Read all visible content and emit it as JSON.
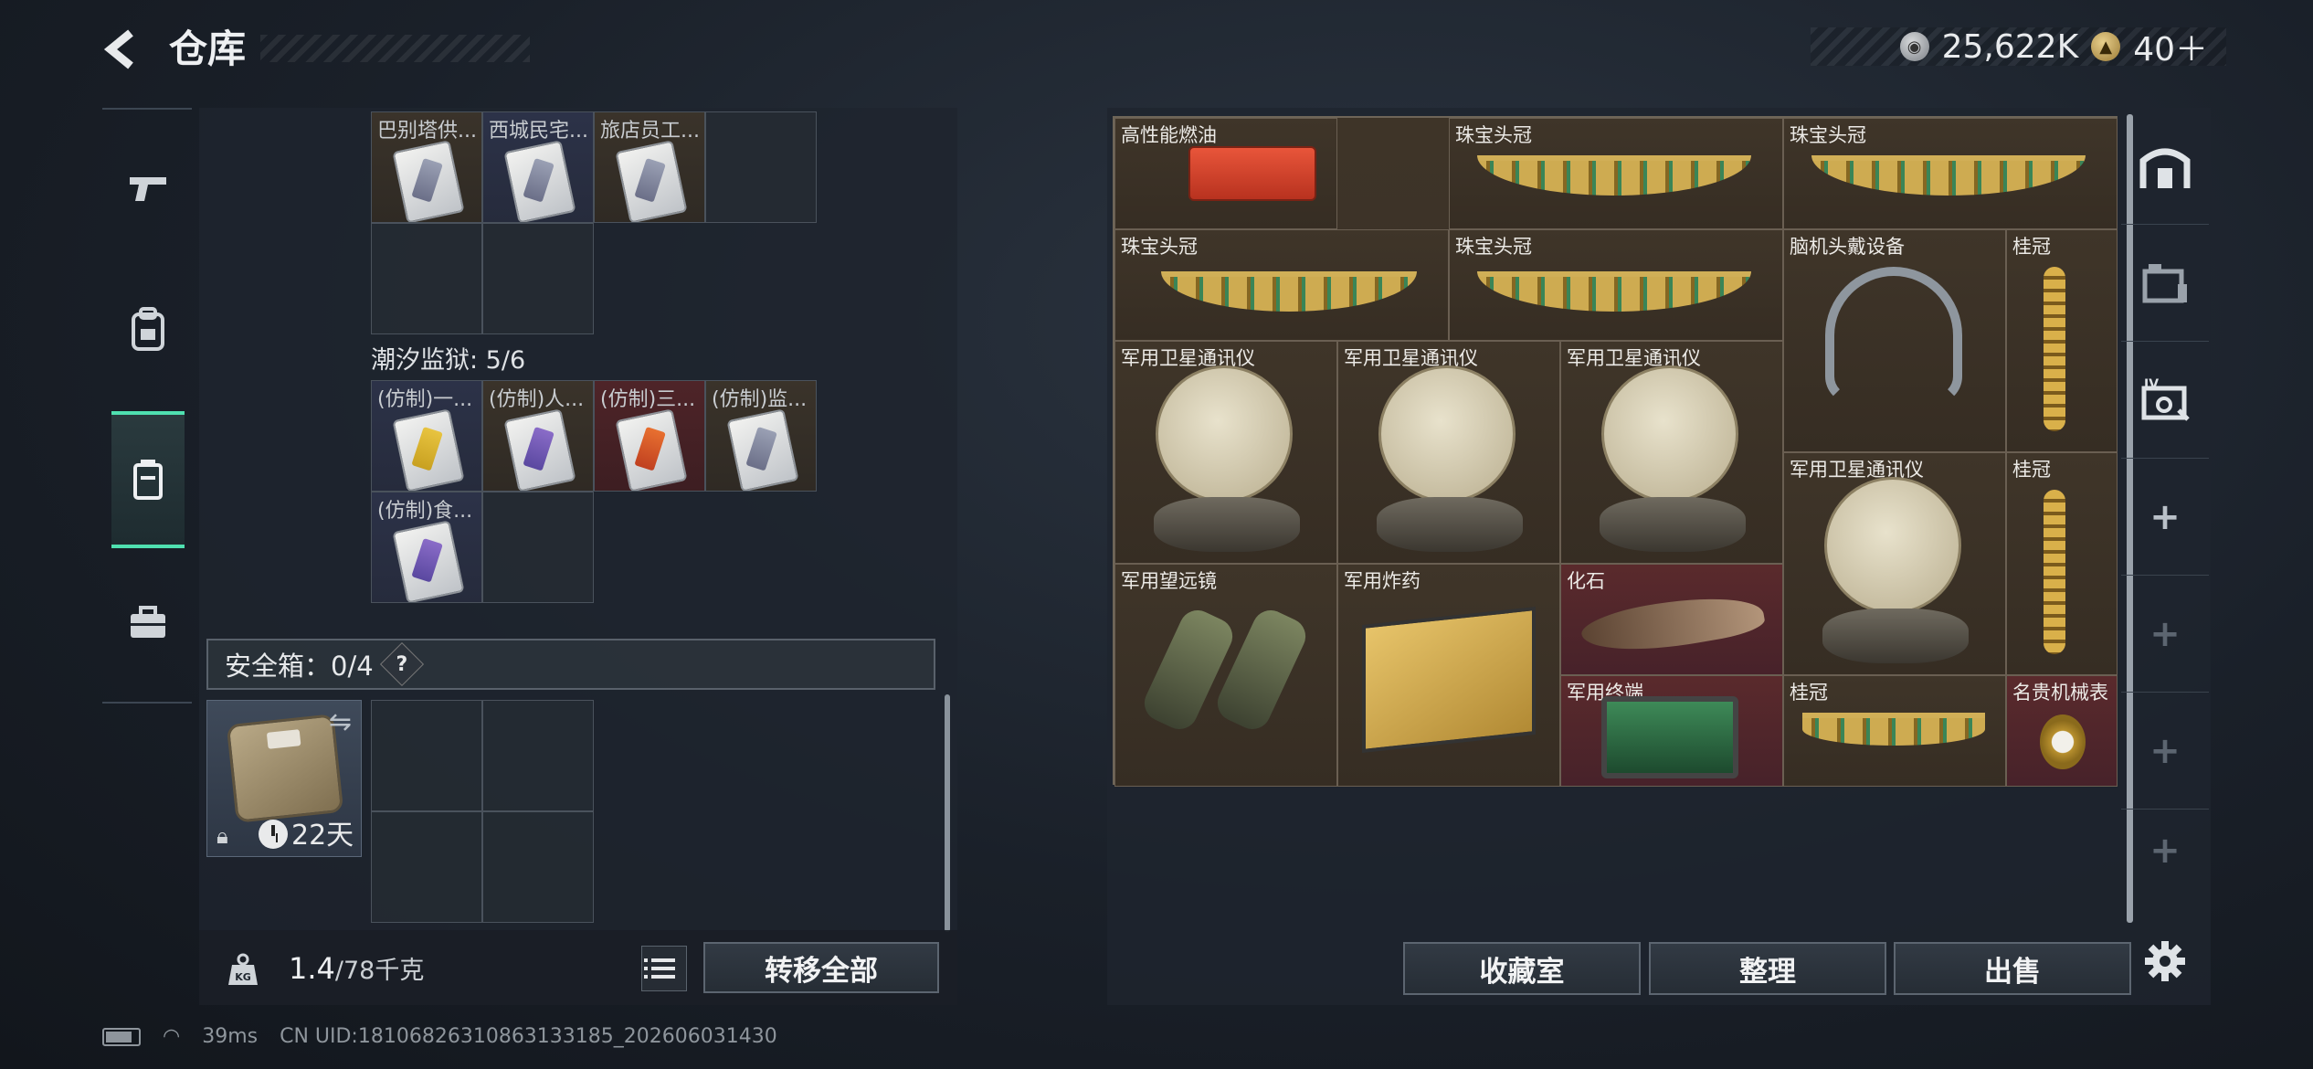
{
  "header": {
    "title": "仓库"
  },
  "currency": {
    "coin_amount": "25,622K",
    "gold_amount": "40＋"
  },
  "left_tabs": [
    {
      "name": "weapons",
      "icon": "pistol-icon"
    },
    {
      "name": "gear",
      "icon": "backpack-icon"
    },
    {
      "name": "storage",
      "icon": "container-icon",
      "active": true
    },
    {
      "name": "supplies",
      "icon": "toolbox-icon"
    }
  ],
  "top_items": [
    "巴别塔供...",
    "西城民宅...",
    "旅店员工..."
  ],
  "prison": {
    "title": "潮汐监狱: 5/6",
    "items": [
      "(仿制)一...",
      "(仿制)人...",
      "(仿制)三...",
      "(仿制)监...",
      "(仿制)食..."
    ]
  },
  "safe": {
    "title": "安全箱：0/4",
    "help": "?",
    "days": "22天"
  },
  "weight": {
    "value": "1.4",
    "limit": "/78千克"
  },
  "buttons": {
    "transfer_all": "转移全部",
    "collection": "收藏室",
    "sort": "整理",
    "sell": "出售"
  },
  "stash_items": [
    {
      "label": "高性能燃油",
      "icon": "fuel-case-icon"
    },
    {
      "label": "珠宝头冠",
      "icon": "tiara-icon"
    },
    {
      "label": "珠宝头冠",
      "icon": "tiara-icon"
    },
    {
      "label": "珠宝头冠",
      "icon": "tiara-icon"
    },
    {
      "label": "珠宝头冠",
      "icon": "tiara-icon"
    },
    {
      "label": "脑机头戴设备",
      "icon": "headset-icon"
    },
    {
      "label": "桂冠",
      "icon": "laurel-icon"
    },
    {
      "label": "军用卫星通讯仪",
      "icon": "satellite-dish-icon"
    },
    {
      "label": "军用卫星通讯仪",
      "icon": "satellite-dish-icon"
    },
    {
      "label": "军用卫星通讯仪",
      "icon": "satellite-dish-icon"
    },
    {
      "label": "军用卫星通讯仪",
      "icon": "satellite-dish-icon"
    },
    {
      "label": "桂冠",
      "icon": "laurel-icon"
    },
    {
      "label": "军用望远镜",
      "icon": "binoculars-icon"
    },
    {
      "label": "军用炸药",
      "icon": "explosive-crate-icon"
    },
    {
      "label": "化石",
      "icon": "fossil-icon"
    },
    {
      "label": "军用终端",
      "icon": "terminal-icon"
    },
    {
      "label": "桂冠",
      "icon": "laurel-icon"
    },
    {
      "label": "名贵机械表",
      "icon": "watch-icon"
    }
  ],
  "status_bar": {
    "ping": "39ms",
    "uid": "CN UID:18106826310863133185_202606031430"
  },
  "colors": {
    "accent": "#4fe0b0",
    "rare_red": "#5a2a2c",
    "stash_brown": "#3e3428"
  }
}
